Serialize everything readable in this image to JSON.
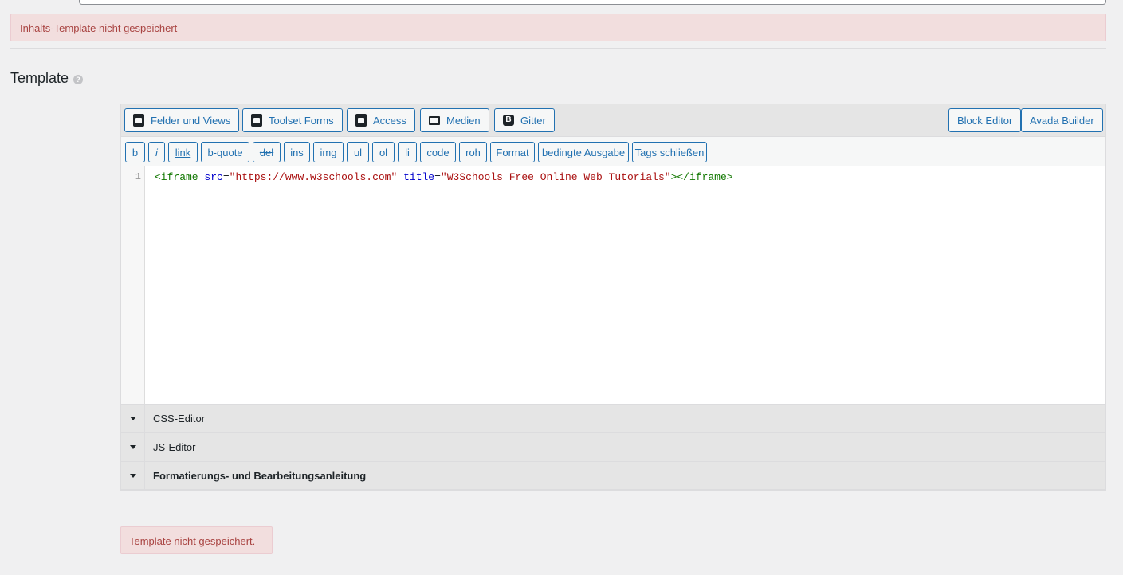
{
  "notices": {
    "top": "Inhalts-Template nicht gespeichert",
    "bottom": "Template nicht gespeichert."
  },
  "section": {
    "title": "Template",
    "help_icon": "?"
  },
  "toolbar_main": {
    "fields_views": "Felder und Views",
    "toolset_forms": "Toolset Forms",
    "access": "Access",
    "media": "Medien",
    "grid": "Gitter",
    "grid_icon_letter": "B",
    "block_editor": "Block Editor",
    "avada_builder": "Avada Builder"
  },
  "quicktags": [
    "b",
    "i",
    "link",
    "b-quote",
    "del",
    "ins",
    "img",
    "ul",
    "ol",
    "li",
    "code",
    "roh",
    "Format",
    "bedingte Ausgabe",
    "Tags schließen"
  ],
  "code": {
    "line_number": "1",
    "tag_open": "<iframe",
    "attr_src": "src",
    "eq": "=",
    "val_src": "\"https://www.w3schools.com\"",
    "attr_title": "title",
    "val_title": "\"W3Schools Free Online Web Tutorials\"",
    "tag_close": "></iframe>"
  },
  "accordions": {
    "css": "CSS-Editor",
    "js": "JS-Editor",
    "guide": "Formatierungs- und Bearbeitungsanleitung"
  }
}
